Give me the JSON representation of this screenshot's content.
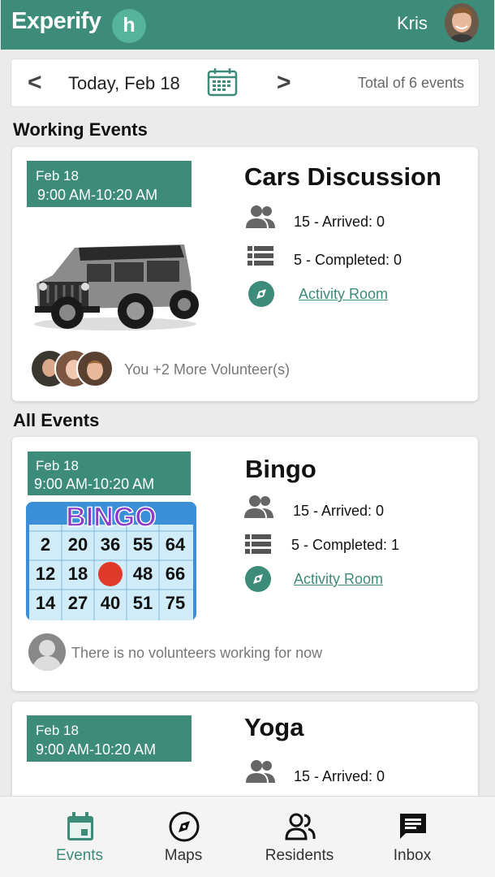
{
  "header": {
    "brand": "Experify",
    "logo_letter": "h",
    "username": "Kris"
  },
  "datebar": {
    "prev": "<",
    "next": ">",
    "date": "Today, Feb 18",
    "total": "Total of 6 events"
  },
  "sections": {
    "working": "Working Events",
    "all": "All Events"
  },
  "events": [
    {
      "date": "Feb 18",
      "time": "9:00 AM-10:20 AM",
      "title": "Cars Discussion",
      "arrived": "15 - Arrived: 0",
      "completed": "5 - Completed: 0",
      "location": "Activity Room",
      "volunteers": "You +2 More Volunteer(s)"
    },
    {
      "date": "Feb 18",
      "time": "9:00 AM-10:20 AM",
      "title": "Bingo",
      "arrived": "15 - Arrived: 0",
      "completed": "5 - Completed: 1",
      "location": "Activity Room",
      "volunteers": "There is no volunteers working for now",
      "bingo_letters": "BINGO",
      "bingo_rows": [
        [
          "2",
          "20",
          "36",
          "55",
          "64"
        ],
        [
          "12",
          "18",
          "",
          "48",
          "66"
        ],
        [
          "14",
          "27",
          "40",
          "51",
          "75"
        ]
      ]
    },
    {
      "date": "Feb 18",
      "time": "9:00 AM-10:20 AM",
      "title": "Yoga",
      "arrived": "15 - Arrived: 0"
    }
  ],
  "bottom_nav": [
    {
      "label": "Events",
      "icon": "calendar-icon",
      "active": true
    },
    {
      "label": "Maps",
      "icon": "compass-icon",
      "active": false
    },
    {
      "label": "Residents",
      "icon": "people-icon",
      "active": false
    },
    {
      "label": "Inbox",
      "icon": "message-icon",
      "active": false
    }
  ],
  "colors": {
    "primary": "#3d8b79",
    "logo_circle": "#55b49a",
    "background": "#ebebeb"
  }
}
